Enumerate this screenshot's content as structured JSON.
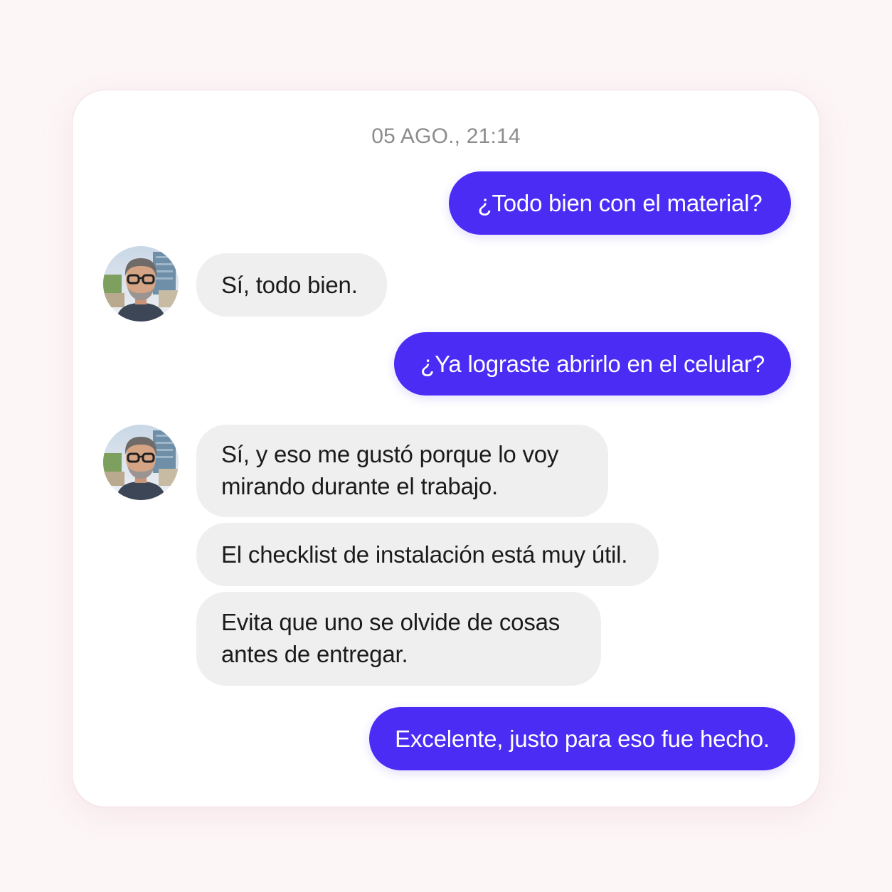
{
  "conversation": {
    "timestamp": "05 AGO., 21:14",
    "messages": [
      {
        "from": "me",
        "text": "¿Todo bien con el material?"
      },
      {
        "from": "contact",
        "text": "Sí, todo bien."
      },
      {
        "from": "me",
        "text": "¿Ya lograste abrirlo en el celular?"
      },
      {
        "from": "contact",
        "lines": [
          "Sí, y eso me gustó porque lo voy",
          "mirando durante el trabajo."
        ]
      },
      {
        "from": "contact",
        "text": "El checklist de instalación está muy útil."
      },
      {
        "from": "contact",
        "lines": [
          "Evita que uno se olvide de cosas",
          "antes de entregar."
        ]
      },
      {
        "from": "me",
        "text": "Excelente, justo para eso fue hecho."
      }
    ]
  },
  "contact": {
    "avatar_icon": "person-photo-avatar"
  },
  "colors": {
    "sent_bubble": "#4a2cf5",
    "received_bubble": "#efefef",
    "background": "#fcf6f7",
    "timestamp": "#8c8c8f"
  }
}
